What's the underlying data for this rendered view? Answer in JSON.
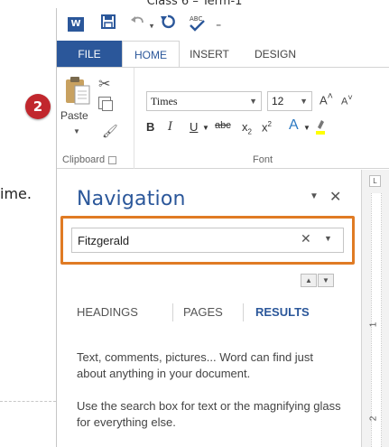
{
  "header": {
    "title": "Class 6 – Term-1"
  },
  "step_badge": "2",
  "side_text": "ime.",
  "qat": {
    "app_icon_label": "W",
    "buttons": [
      "save-icon",
      "undo-icon",
      "redo-icon",
      "spelling-icon",
      "customize-caret"
    ]
  },
  "ribbon_tabs": [
    "FILE",
    "HOME",
    "INSERT",
    "DESIGN"
  ],
  "clipboard": {
    "paste_label": "Paste",
    "group_label": "Clipboard"
  },
  "font": {
    "font_name": "Times",
    "font_size": "12",
    "grow_label": "A",
    "shrink_label": "A",
    "bold": "B",
    "italic": "I",
    "underline": "U",
    "strike": "abc",
    "subscript": "x",
    "superscript": "x",
    "effects": "A",
    "group_label": "Font"
  },
  "navigation": {
    "title": "Navigation",
    "search_value": "Fitzgerald",
    "tabs": [
      "HEADINGS",
      "PAGES",
      "RESULTS"
    ],
    "active_tab": "RESULTS",
    "message": [
      "Text, comments, pictures... Word can find just about anything in your document.",
      "Use the search box for text or the magnifying glass for everything else."
    ]
  },
  "ruler": {
    "corner": "L",
    "numbers": [
      "1",
      "2"
    ]
  },
  "colors": {
    "accent": "#2b579a",
    "highlight": "#e07b24",
    "badge": "#c1272d"
  }
}
